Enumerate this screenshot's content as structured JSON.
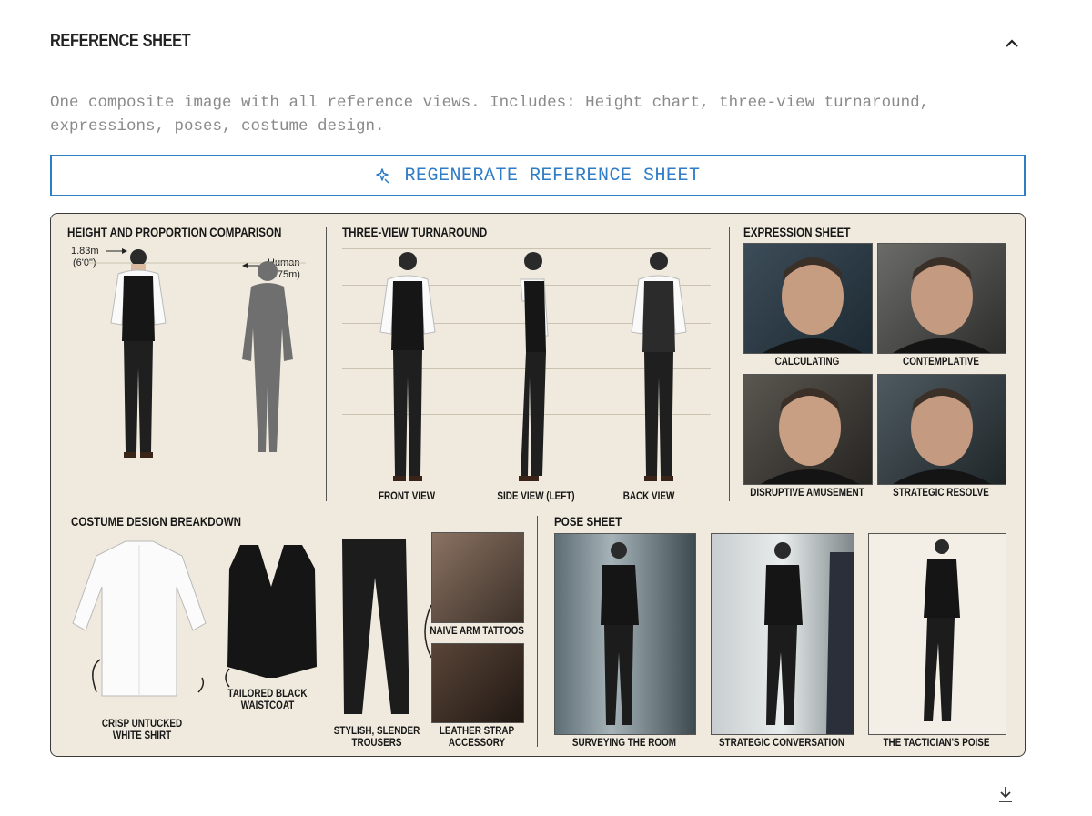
{
  "section": {
    "title": "REFERENCE SHEET",
    "collapse_icon": "chevron-up-icon",
    "description": "One composite image with all reference views. Includes: Height chart, three-view turnaround, expressions, poses, costume design.",
    "regenerate_label": "REGENERATE REFERENCE SHEET",
    "regenerate_icon": "sparkle-icon",
    "download_icon": "download-icon",
    "accent_color": "#2f7dc6"
  },
  "sheet": {
    "height": {
      "title": "HEIGHT AND PROPORTION COMPARISON",
      "character_height": "1.83m",
      "character_height_ft": "(6'0\")",
      "human_label": "Human",
      "human_height": "(1.75m)"
    },
    "turnaround": {
      "title": "THREE-VIEW TURNAROUND",
      "views": [
        "FRONT VIEW",
        "SIDE VIEW (LEFT)",
        "BACK VIEW"
      ]
    },
    "expressions": {
      "title": "EXPRESSION SHEET",
      "items": [
        "CALCULATING",
        "CONTEMPLATIVE",
        "DISRUPTIVE AMUSEMENT",
        "STRATEGIC RESOLVE"
      ]
    },
    "costume": {
      "title": "COSTUME DESIGN BREAKDOWN",
      "shirt": [
        "CRISP UNTUCKED",
        "WHITE SHIRT"
      ],
      "waistcoat": [
        "TAILORED BLACK",
        "WAISTCOAT"
      ],
      "trousers": [
        "STYLISH, SLENDER",
        "TROUSERS"
      ],
      "tattoos": "NAIVE ARM TATTOOS",
      "accessory": [
        "LEATHER STRAP",
        "ACCESSORY"
      ]
    },
    "poses": {
      "title": "POSE SHEET",
      "items": [
        "SURVEYING THE ROOM",
        "STRATEGIC CONVERSATION",
        "THE TACTICIAN'S POISE"
      ]
    }
  }
}
